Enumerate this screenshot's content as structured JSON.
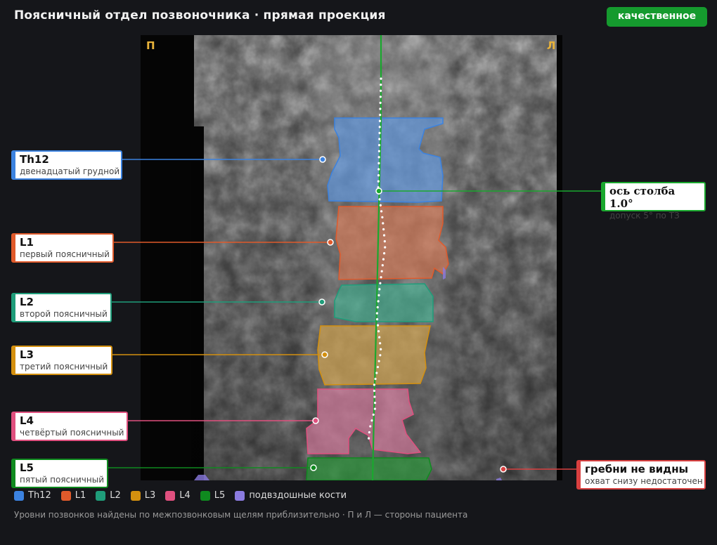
{
  "header": {
    "title": "Поясничный отдел позвоночника · прямая проекция",
    "badge": "качественное"
  },
  "viewer": {
    "side_right_patient": "П",
    "side_left_patient": "Л"
  },
  "callouts": {
    "th12": {
      "name": "Th12",
      "sub": "двенадцатый грудной"
    },
    "l1": {
      "name": "L1",
      "sub": "первый поясничный"
    },
    "l2": {
      "name": "L2",
      "sub": "второй поясничный"
    },
    "l3": {
      "name": "L3",
      "sub": "третий поясничный"
    },
    "l4": {
      "name": "L4",
      "sub": "четвёртый поясничный"
    },
    "l5": {
      "name": "L5",
      "sub": "пятый поясничный"
    },
    "axis": {
      "name": "ось столба 1.0°",
      "sub": "допуск 5° по ТЗ"
    },
    "crests": {
      "name": "гребни не видны",
      "sub": "охват снизу недостаточен"
    }
  },
  "colors": {
    "th12": "#3b82e0",
    "l1": "#e05a2b",
    "l2": "#1f9d7a",
    "l3": "#d4900f",
    "l4": "#e0507f",
    "l5": "#0f8a1f",
    "iliac": "#8b7be0",
    "axis": "#1aa82e",
    "crests": "#d94040"
  },
  "legend": [
    {
      "label": "Th12",
      "color": "#3b82e0"
    },
    {
      "label": "L1",
      "color": "#e05a2b"
    },
    {
      "label": "L2",
      "color": "#1f9d7a"
    },
    {
      "label": "L3",
      "color": "#d4900f"
    },
    {
      "label": "L4",
      "color": "#e0507f"
    },
    {
      "label": "L5",
      "color": "#0f8a1f"
    },
    {
      "label": "подвздошные кости",
      "color": "#8b7be0"
    }
  ],
  "footnote": "Уровни позвонков найдены по межпозвонковым щелям приблизительно · П и Л — стороны пациента"
}
